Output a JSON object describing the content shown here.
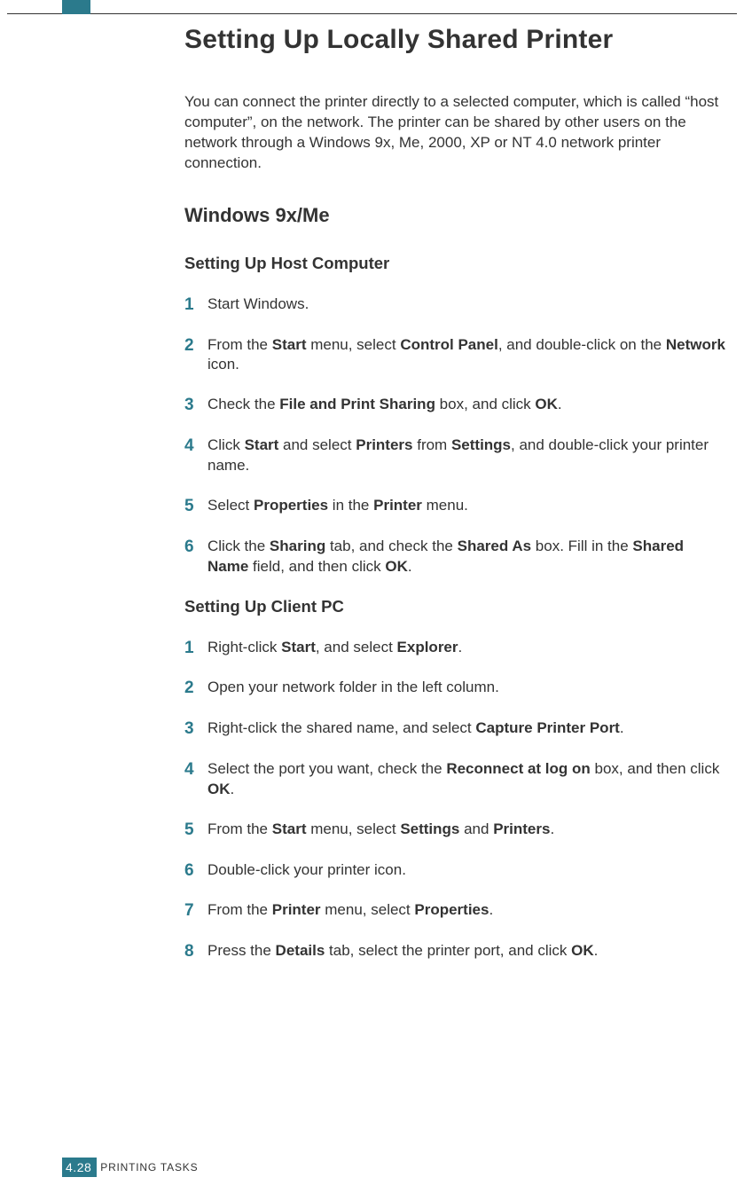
{
  "header": {
    "title": "Setting Up Locally Shared Printer",
    "intro": "You can connect the printer directly to a selected computer, which is called “host computer”, on the network. The printer can be shared by other users on the network through a Windows 9x, Me, 2000, XP or NT 4.0 network printer connection."
  },
  "section1": {
    "title": "Windows 9x/Me",
    "subA": {
      "title": "Setting Up Host Computer",
      "steps": [
        {
          "n": "1",
          "html": "Start Windows."
        },
        {
          "n": "2",
          "html": "From the <b>Start</b> menu, select <b>Control Panel</b>, and double-click on the <b>Network</b> icon."
        },
        {
          "n": "3",
          "html": "Check the <b>File and Print Sharing</b> box, and click <b>OK</b>."
        },
        {
          "n": "4",
          "html": "Click <b>Start</b> and select <b>Printers</b> from <b>Settings</b>, and double-click your printer name."
        },
        {
          "n": "5",
          "html": "Select <b>Properties</b> in the <b>Printer</b> menu."
        },
        {
          "n": "6",
          "html": "Click the <b>Sharing</b> tab, and check the <b>Shared As</b> box. Fill in the <b>Shared Name</b> field, and then click <b>OK</b>."
        }
      ]
    },
    "subB": {
      "title": "Setting Up Client PC",
      "steps": [
        {
          "n": "1",
          "html": "Right-click <b>Start</b>, and select <b>Explorer</b>."
        },
        {
          "n": "2",
          "html": "Open your network folder in the left column."
        },
        {
          "n": "3",
          "html": "Right-click the shared name, and select <b>Capture Printer Port</b>."
        },
        {
          "n": "4",
          "html": "Select the port you want, check the <b>Reconnect at log on</b> box, and then click <b>OK</b>."
        },
        {
          "n": "5",
          "html": "From the <b>Start</b> menu, select <b>Settings</b> and <b>Printers</b>."
        },
        {
          "n": "6",
          "html": "Double-click your printer icon."
        },
        {
          "n": "7",
          "html": "From the <b>Printer</b> menu, select <b>Properties</b>."
        },
        {
          "n": "8",
          "html": "Press the <b>Details</b> tab, select the printer port, and click <b>OK</b>."
        }
      ]
    }
  },
  "footer": {
    "chapter": "4.",
    "page": "28",
    "title": "PRINTING TASKS"
  }
}
